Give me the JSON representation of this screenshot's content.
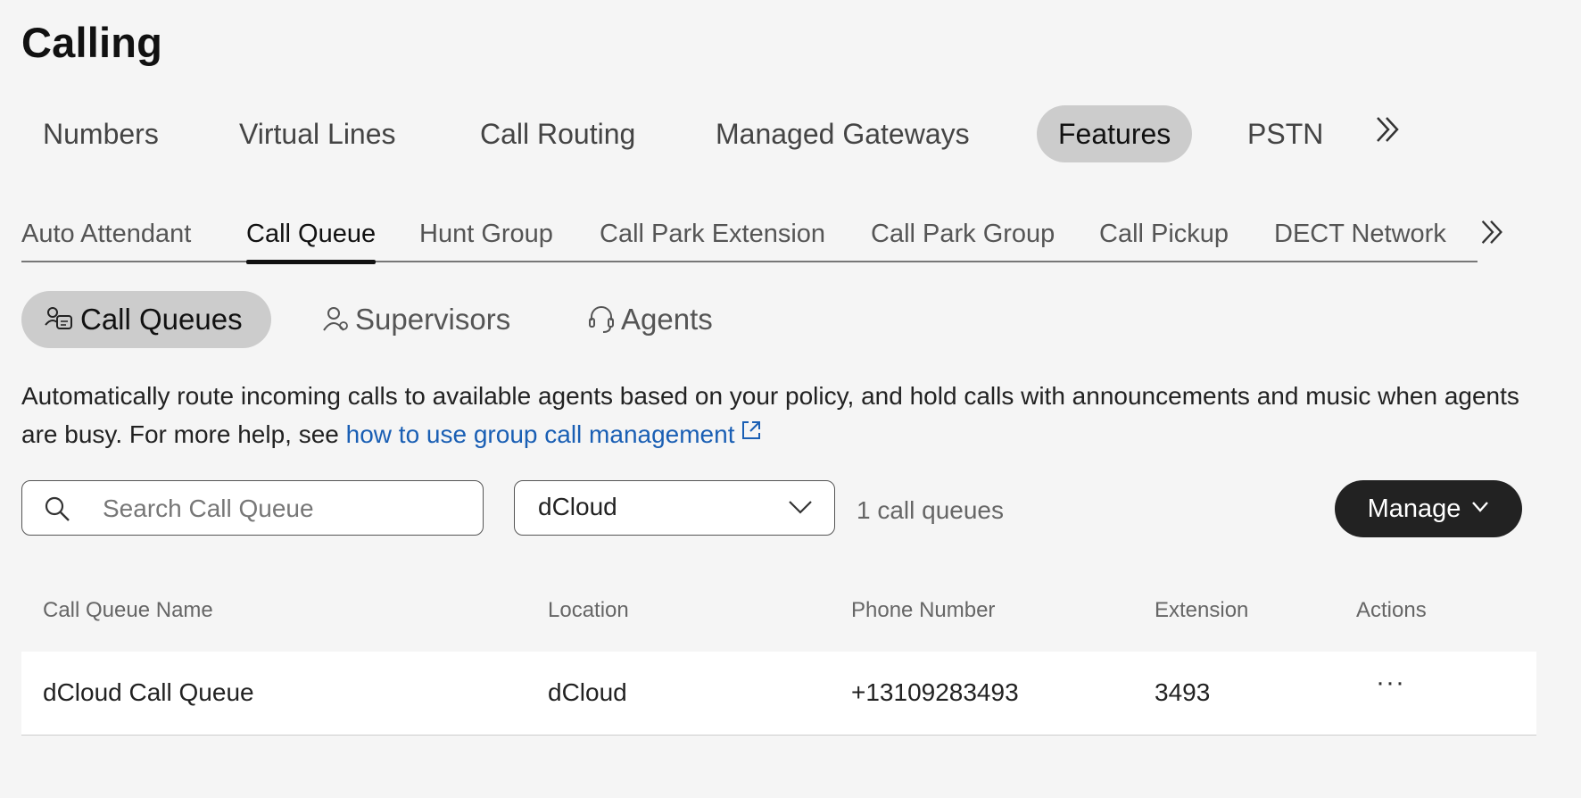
{
  "page": {
    "title": "Calling"
  },
  "main_tabs": [
    {
      "label": "Numbers"
    },
    {
      "label": "Virtual Lines"
    },
    {
      "label": "Call Routing"
    },
    {
      "label": "Managed Gateways"
    },
    {
      "label": "Features",
      "active": true
    },
    {
      "label": "PSTN"
    }
  ],
  "sub_tabs": [
    {
      "label": "Auto Attendant"
    },
    {
      "label": "Call Queue",
      "active": true
    },
    {
      "label": "Hunt Group"
    },
    {
      "label": "Call Park Extension"
    },
    {
      "label": "Call Park Group"
    },
    {
      "label": "Call Pickup"
    },
    {
      "label": "DECT Network"
    }
  ],
  "pill_tabs": [
    {
      "label": "Call Queues",
      "icon": "call-queues-icon",
      "active": true
    },
    {
      "label": "Supervisors",
      "icon": "supervisor-icon"
    },
    {
      "label": "Agents",
      "icon": "headset-icon"
    }
  ],
  "description": {
    "text": "Automatically route incoming calls to available agents based on your policy, and hold calls with announcements and music when agents are busy. For more help, see ",
    "link": "how to use group call management"
  },
  "controls": {
    "search_placeholder": "Search Call Queue",
    "location_selected": "dCloud",
    "count": "1 call queues",
    "manage_label": "Manage"
  },
  "table": {
    "headers": [
      "Call Queue Name",
      "Location",
      "Phone Number",
      "Extension",
      "Actions"
    ],
    "rows": [
      {
        "name": "dCloud Call Queue",
        "location": "dCloud",
        "phone": "+13109283493",
        "extension": "3493",
        "actions": "···"
      }
    ]
  },
  "colors": {
    "background": "#f5f5f5",
    "active_pill": "#cccccc",
    "primary_button": "#222222",
    "link": "#1a5fb4"
  }
}
